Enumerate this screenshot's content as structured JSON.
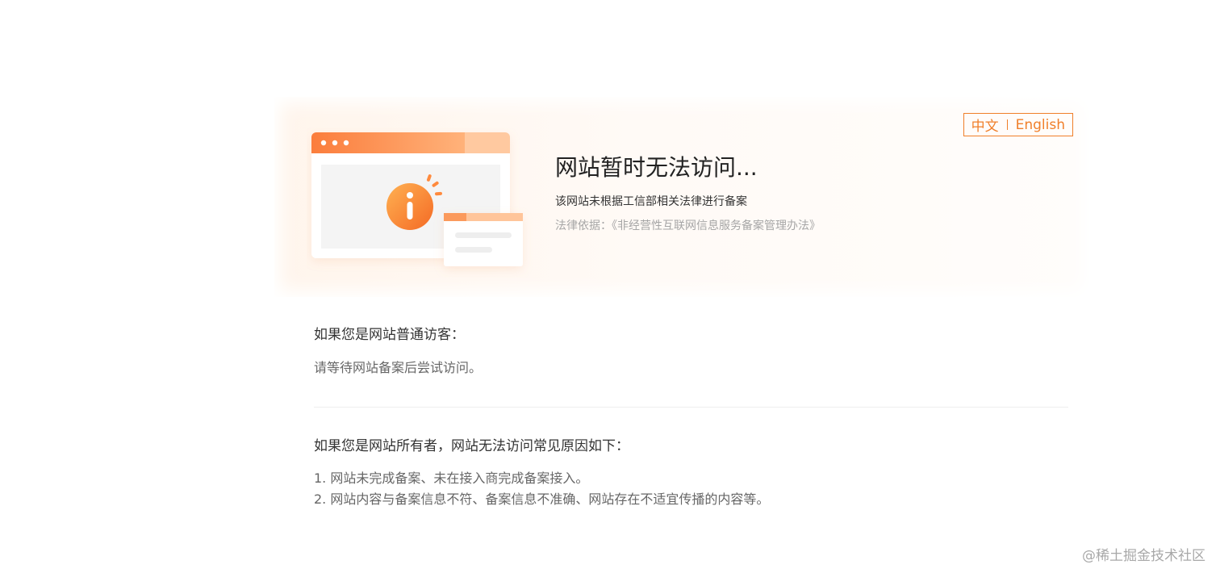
{
  "language_switch": {
    "chinese": "中文",
    "english": "English"
  },
  "hero": {
    "title": "网站暂时无法访问...",
    "description": "该网站未根据工信部相关法律进行备案",
    "legal_basis": "法律依据：《非经营性互联网信息服务备案管理办法》"
  },
  "visitor_section": {
    "heading": "如果您是网站普通访客：",
    "text": "请等待网站备案后尝试访问。"
  },
  "owner_section": {
    "heading": "如果您是网站所有者，网站无法访问常见原因如下：",
    "reasons": [
      "1. 网站未完成备案、未在接入商完成备案接入。",
      "2. 网站内容与备案信息不符、备案信息不准确、网站存在不适宜传播的内容等。"
    ]
  },
  "watermark": "@稀土掘金技术社区",
  "icons": {
    "illustration": "browser-window-info-icon"
  },
  "colors": {
    "accent": "#f07f2a",
    "banner_bg": "#fff6ee",
    "title_text": "#222222",
    "muted_text": "#a6a6a6"
  }
}
